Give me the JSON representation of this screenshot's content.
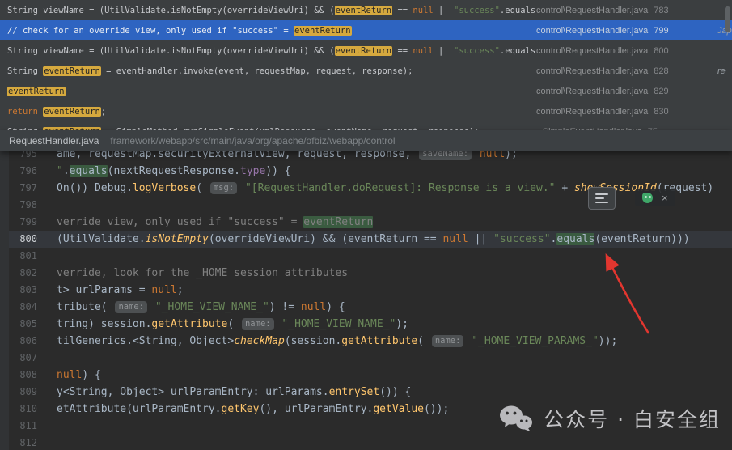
{
  "colors": {
    "selection_blue": "#2e64c1",
    "match_highlight_yellow": "#d6a93e",
    "editor_match_green": "#3a5b40",
    "arrow_red": "#e2362f",
    "editor_background": "#2b2b2b",
    "panel_background": "#3b3e40"
  },
  "results": {
    "rows": [
      {
        "selected": false,
        "file": "control\\RequestHandler.java",
        "line": "783",
        "edge": "",
        "code": [
          {
            "t": "String viewName = (UtilValidate.isNotEmpty(overrideViewUri) && ("
          },
          {
            "t": "eventReturn",
            "c": "hl"
          },
          {
            "t": " == "
          },
          {
            "t": "null",
            "c": "kw"
          },
          {
            "t": " || "
          },
          {
            "t": "\"success\"",
            "c": "str"
          },
          {
            "t": ".equals("
          },
          {
            "t": "eventRe",
            "c": "hl"
          }
        ]
      },
      {
        "selected": true,
        "file": "control\\RequestHandler.java",
        "line": "799",
        "edge": "Jap",
        "code": [
          {
            "t": "// check for an override view, only used if \"success\" = ",
            "c": "cmt"
          },
          {
            "t": "eventReturn",
            "c": "hl"
          }
        ]
      },
      {
        "selected": false,
        "file": "control\\RequestHandler.java",
        "line": "800",
        "edge": "",
        "code": [
          {
            "t": "String viewName = (UtilValidate.isNotEmpty(overrideViewUri) && ("
          },
          {
            "t": "eventReturn",
            "c": "hl"
          },
          {
            "t": " == "
          },
          {
            "t": "null",
            "c": "kw"
          },
          {
            "t": " || "
          },
          {
            "t": "\"success\"",
            "c": "str"
          },
          {
            "t": ".equals("
          },
          {
            "t": "eventRe",
            "c": "hl"
          }
        ]
      },
      {
        "selected": false,
        "file": "control\\RequestHandler.java",
        "line": "828",
        "edge": "re",
        "code": [
          {
            "t": "String "
          },
          {
            "t": "eventReturn",
            "c": "hl"
          },
          {
            "t": " = eventHandler.invoke(event, requestMap, request, response);"
          }
        ]
      },
      {
        "selected": false,
        "file": "control\\RequestHandler.java",
        "line": "829",
        "edge": "",
        "code": [
          {
            "t": "eventReturn",
            "c": "hl"
          }
        ]
      },
      {
        "selected": false,
        "file": "control\\RequestHandler.java",
        "line": "830",
        "edge": "",
        "code": [
          {
            "t": "return ",
            "c": "kw"
          },
          {
            "t": "eventReturn",
            "c": "hl"
          },
          {
            "t": ";"
          }
        ]
      },
      {
        "selected": false,
        "file": "SimpleEventHandler.java",
        "line": "75",
        "edge": "",
        "code": [
          {
            "t": "String "
          },
          {
            "t": "eventReturn",
            "c": "hl"
          },
          {
            "t": " = SimpleMethod.runSimpleEvent(xmlResource, eventName, request, response);"
          }
        ]
      }
    ]
  },
  "breadcrumb": {
    "file": "RequestHandler.java",
    "path": "framework/webapp/src/main/java/org/apache/ofbiz/webapp/control"
  },
  "editor": {
    "current_line": "800",
    "lines": [
      {
        "n": "795",
        "code": [
          {
            "t": "ame, requestMap.securityExternalView, request, response, "
          },
          {
            "t": "saveName:",
            "c": "hint"
          },
          {
            "t": " "
          },
          {
            "t": "null",
            "c": "kw"
          },
          {
            "t": ");"
          }
        ]
      },
      {
        "n": "796",
        "code": [
          {
            "t": "\"",
            "c": "str"
          },
          {
            "t": "."
          },
          {
            "t": "equals",
            "c": "hlg"
          },
          {
            "t": "(nextRequestResponse."
          },
          {
            "t": "type",
            "c": "field"
          },
          {
            "t": ")) {"
          }
        ]
      },
      {
        "n": "797",
        "code": [
          {
            "t": "On()) Debug."
          },
          {
            "t": "logVerbose",
            "c": "meth"
          },
          {
            "t": "( "
          },
          {
            "t": "msg:",
            "c": "hint"
          },
          {
            "t": " "
          },
          {
            "t": "\"[RequestHandler.doRequest]: Response is a view.\"",
            "c": "str"
          },
          {
            "t": " + "
          },
          {
            "t": "showSessionId",
            "c": "meth it"
          },
          {
            "t": "(request)"
          }
        ]
      },
      {
        "n": "798",
        "code": []
      },
      {
        "n": "799",
        "code": [
          {
            "t": "verride view, only used if \"success\" = ",
            "c": "cmt"
          },
          {
            "t": "eventReturn",
            "c": "cmt hlg"
          }
        ]
      },
      {
        "n": "800",
        "current": true,
        "code": [
          {
            "t": "(UtilValidate."
          },
          {
            "t": "isNotEmpty",
            "c": "meth it"
          },
          {
            "t": "("
          },
          {
            "t": "overrideViewUri",
            "c": "ul"
          },
          {
            "t": ") && ("
          },
          {
            "t": "eventReturn",
            "c": "ul"
          },
          {
            "t": " == "
          },
          {
            "t": "null",
            "c": "kw"
          },
          {
            "t": " || "
          },
          {
            "t": "\"success\"",
            "c": "str"
          },
          {
            "t": "."
          },
          {
            "t": "equals",
            "c": "hlg"
          },
          {
            "t": "(eventReturn)))"
          }
        ]
      },
      {
        "n": "801",
        "code": []
      },
      {
        "n": "802",
        "code": [
          {
            "t": "verride, look for the _HOME session attributes",
            "c": "cmt"
          }
        ]
      },
      {
        "n": "803",
        "code": [
          {
            "t": "t> "
          },
          {
            "t": "urlParams",
            "c": "ul"
          },
          {
            "t": " = "
          },
          {
            "t": "null",
            "c": "kw"
          },
          {
            "t": ";"
          }
        ]
      },
      {
        "n": "804",
        "code": [
          {
            "t": "tribute( "
          },
          {
            "t": "name:",
            "c": "hint"
          },
          {
            "t": " "
          },
          {
            "t": "\"_HOME_VIEW_NAME_\"",
            "c": "str"
          },
          {
            "t": ") != "
          },
          {
            "t": "null",
            "c": "kw"
          },
          {
            "t": ") {"
          }
        ]
      },
      {
        "n": "805",
        "code": [
          {
            "t": "tring) session."
          },
          {
            "t": "getAttribute",
            "c": "meth"
          },
          {
            "t": "( "
          },
          {
            "t": "name:",
            "c": "hint"
          },
          {
            "t": " "
          },
          {
            "t": "\"_HOME_VIEW_NAME_\"",
            "c": "str"
          },
          {
            "t": ");"
          }
        ]
      },
      {
        "n": "806",
        "code": [
          {
            "t": "tilGenerics.<String, Object>"
          },
          {
            "t": "checkMap",
            "c": "meth it"
          },
          {
            "t": "(session."
          },
          {
            "t": "getAttribute",
            "c": "meth"
          },
          {
            "t": "( "
          },
          {
            "t": "name:",
            "c": "hint"
          },
          {
            "t": " "
          },
          {
            "t": "\"_HOME_VIEW_PARAMS_\"",
            "c": "str"
          },
          {
            "t": "));"
          }
        ]
      },
      {
        "n": "807",
        "code": []
      },
      {
        "n": "808",
        "code": [
          {
            "t": "null",
            "c": "kw"
          },
          {
            "t": ") {"
          }
        ]
      },
      {
        "n": "809",
        "code": [
          {
            "t": "y<String, Object> urlParamEntry: "
          },
          {
            "t": "urlParams",
            "c": "ul"
          },
          {
            "t": "."
          },
          {
            "t": "entrySet",
            "c": "meth"
          },
          {
            "t": "()) {"
          }
        ]
      },
      {
        "n": "810",
        "code": [
          {
            "t": "etAttribute(urlParamEntry."
          },
          {
            "t": "getKey",
            "c": "meth"
          },
          {
            "t": "(), urlParamEntry."
          },
          {
            "t": "getValue",
            "c": "meth"
          },
          {
            "t": "());"
          }
        ]
      },
      {
        "n": "811",
        "code": []
      },
      {
        "n": "812",
        "code": []
      }
    ]
  },
  "overlay": {
    "close_glyph": "×",
    "watermark_text": "公众号 · 白安全组",
    "icons": [
      "wrap-lines-icon",
      "screenshot-tool-icon",
      "close-icon",
      "wechat-icon",
      "annotation-arrow"
    ]
  }
}
